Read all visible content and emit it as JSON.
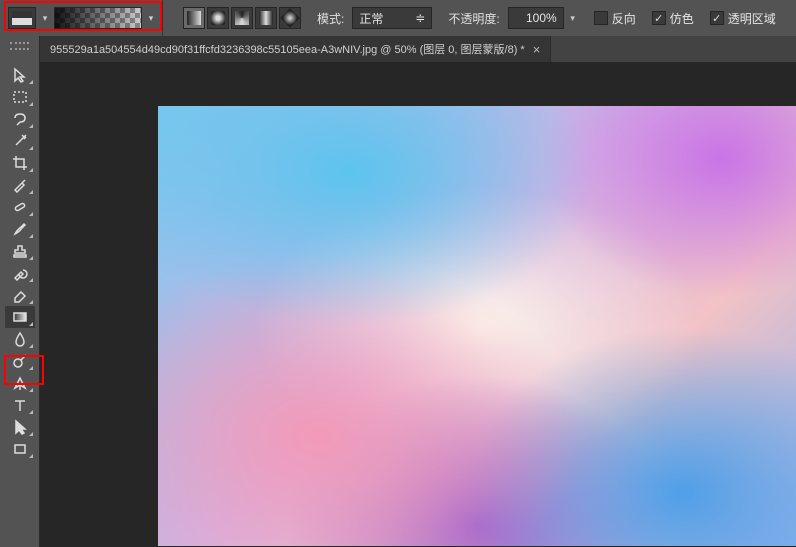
{
  "options": {
    "mode_label": "模式:",
    "mode_value": "正常",
    "opacity_label": "不透明度:",
    "opacity_value": "100%",
    "reverse": {
      "label": "反向",
      "checked": false
    },
    "dither": {
      "label": "仿色",
      "checked": true
    },
    "transparency": {
      "label": "透明区域",
      "checked": true
    }
  },
  "tab": {
    "title": "955529a1a504554d49cd90f31ffcfd3236398c55105eea-A3wNIV.jpg @ 50% (图层 0, 图层蒙版/8) *",
    "close": "×"
  },
  "tools": [
    "move-tool",
    "marquee-tool",
    "lasso-tool",
    "magic-wand-tool",
    "crop-tool",
    "eyedropper-tool",
    "healing-brush-tool",
    "brush-tool",
    "clone-stamp-tool",
    "history-brush-tool",
    "eraser-tool",
    "gradient-tool",
    "blur-tool",
    "dodge-tool",
    "pen-tool",
    "type-tool",
    "path-selection-tool",
    "rectangle-shape-tool"
  ],
  "active_tool": "gradient-tool",
  "icons": {
    "dropdown": "▾",
    "check": "✓"
  }
}
